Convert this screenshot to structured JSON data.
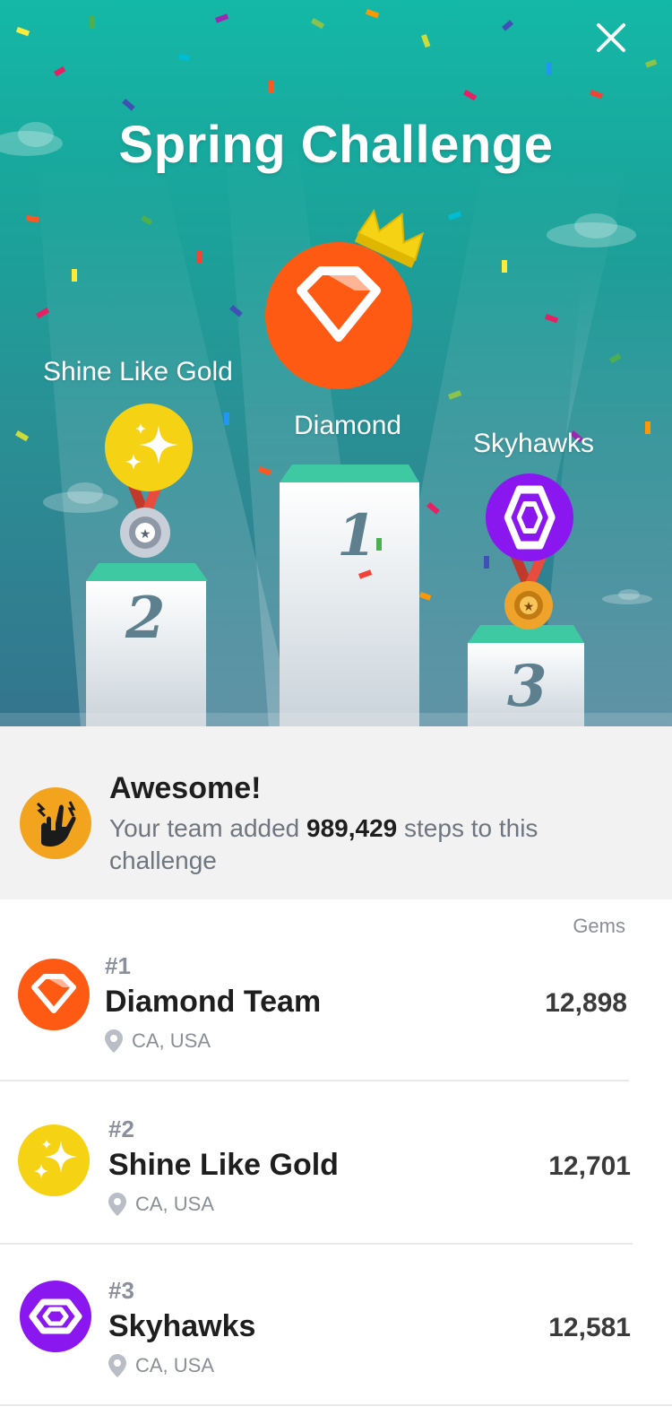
{
  "hero": {
    "title": "Spring Challenge",
    "first": {
      "rank_label": "1",
      "team": "Diamond"
    },
    "second": {
      "rank_label": "2",
      "team": "Shine Like Gold"
    },
    "third": {
      "rank_label": "3",
      "team": "Skyhawks"
    }
  },
  "summary": {
    "title": "Awesome!",
    "text_before": "Your team added ",
    "steps": "989,429",
    "text_after": " steps to this challenge"
  },
  "leaderboard": {
    "column_header": "Gems",
    "rows": [
      {
        "rank": "#1",
        "name": "Diamond Team",
        "location": "CA, USA",
        "gems": "12,898",
        "color": "#ff5a14"
      },
      {
        "rank": "#2",
        "name": "Shine Like Gold",
        "location": "CA, USA",
        "gems": "12,701",
        "color": "#f5d214"
      },
      {
        "rank": "#3",
        "name": "Skyhawks",
        "location": "CA, USA",
        "gems": "12,581",
        "color": "#8a17f0"
      }
    ]
  },
  "icons": {
    "close": "close-icon",
    "location": "location-pin-icon",
    "diamond": "diamond-icon",
    "sparkle": "sparkle-icon",
    "hexagon": "hexagon-icon",
    "rock_hand": "rock-hand-icon"
  }
}
